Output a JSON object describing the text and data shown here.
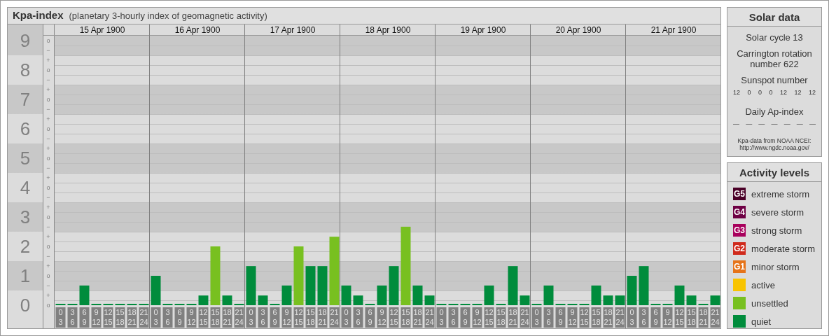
{
  "panel": {
    "title": "Kpa-index",
    "subtitle": "(planetary 3-hourly index of geomagnetic activity)",
    "days": [
      "15 Apr 1900",
      "16 Apr 1900",
      "17 Apr 1900",
      "18 Apr 1900",
      "19 Apr 1900",
      "20 Apr 1900",
      "21 Apr 1900"
    ],
    "third_marks": [
      "o",
      "−",
      "+",
      "o",
      "−",
      "+",
      "o",
      "−",
      "+",
      "o",
      "−",
      "+",
      "o",
      "−",
      "+",
      "o",
      "−",
      "+",
      "o",
      "−",
      "+",
      "o",
      "−",
      "+",
      "o",
      "−",
      "+",
      "o"
    ],
    "chart_data": {
      "type": "bar",
      "ylim": [
        0,
        9.55
      ],
      "grid": true,
      "yticks": [
        {
          "value": 0,
          "label": "0"
        },
        {
          "value": 1,
          "label": "1"
        },
        {
          "value": 2,
          "label": "2"
        },
        {
          "value": 3,
          "label": "3"
        },
        {
          "value": 4,
          "label": "4"
        },
        {
          "value": 5,
          "label": "5"
        },
        {
          "value": 6,
          "label": "6"
        },
        {
          "value": 7,
          "label": "7"
        },
        {
          "value": 8,
          "label": "8"
        },
        {
          "value": 9,
          "label": "9"
        }
      ],
      "categories": [
        "0\n3",
        "3\n6",
        "6\n9",
        "9\n12",
        "12\n15",
        "15\n18",
        "18\n21",
        "21\n24",
        "0\n3",
        "3\n6",
        "6\n9",
        "9\n12",
        "12\n15",
        "15\n18",
        "18\n21",
        "21\n24",
        "0\n3",
        "3\n6",
        "6\n9",
        "9\n12",
        "12\n15",
        "15\n18",
        "18\n21",
        "21\n24",
        "0\n3",
        "3\n6",
        "6\n9",
        "9\n12",
        "12\n15",
        "15\n18",
        "18\n21",
        "21\n24",
        "0\n3",
        "3\n6",
        "6\n9",
        "9\n12",
        "12\n15",
        "15\n18",
        "18\n21",
        "21\n24",
        "0\n3",
        "3\n6",
        "6\n9",
        "9\n12",
        "12\n15",
        "15\n18",
        "18\n21",
        "21\n24",
        "0\n3",
        "3\n6",
        "6\n9",
        "9\n12",
        "12\n15",
        "15\n18",
        "18\n21",
        "21\n24"
      ],
      "series": [
        {
          "color": "#008c3c",
          "values": [
            0,
            0,
            0.67,
            0,
            0,
            0,
            0,
            0,
            1,
            0,
            0,
            0,
            0.33,
            null,
            0.33,
            0,
            1.33,
            0.33,
            0,
            0.67,
            null,
            1.33,
            1.33,
            null,
            0.67,
            0.33,
            0,
            0.67,
            1.33,
            null,
            0.67,
            0.33,
            0,
            0,
            0,
            0,
            0.67,
            0,
            1.33,
            0.33,
            0,
            0.67,
            0,
            0,
            0,
            0.67,
            0.33,
            0.33,
            1,
            1.33,
            0,
            0,
            0.67,
            0.33,
            0,
            0.33
          ]
        },
        {
          "color": "#78c020",
          "values": [
            null,
            null,
            null,
            null,
            null,
            null,
            null,
            null,
            null,
            null,
            null,
            null,
            null,
            2,
            null,
            null,
            null,
            null,
            null,
            null,
            2,
            null,
            null,
            2.33,
            null,
            null,
            null,
            null,
            null,
            2.67,
            null,
            null,
            null,
            null,
            null,
            null,
            null,
            null,
            null,
            null,
            null,
            null,
            null,
            null,
            null,
            null,
            null,
            null,
            null,
            null,
            null,
            null,
            null,
            null,
            null,
            null
          ]
        }
      ]
    }
  },
  "solar_data": {
    "title": "Solar data",
    "solar_cycle": "Solar cycle 13",
    "carrington": "Carrington rotation number 622",
    "sunspot_title": "Sunspot number",
    "sunspot_numbers": [
      "12",
      "0",
      "0",
      "0",
      "12",
      "12",
      "12"
    ],
    "ap_title": "Daily Ap-index",
    "ap_values": [
      "—",
      "—",
      "—",
      "—",
      "—",
      "—",
      "—"
    ],
    "source": "Kpa-data from NOAA NCEI: http://www.ngdc.noaa.gov/"
  },
  "activity_levels": {
    "title": "Activity levels",
    "items": [
      {
        "code": "G5",
        "label": "extreme storm",
        "color": "#4a0027"
      },
      {
        "code": "G4",
        "label": "severe storm",
        "color": "#6e0044"
      },
      {
        "code": "G3",
        "label": "strong storm",
        "color": "#a8005c"
      },
      {
        "code": "G2",
        "label": "moderate storm",
        "color": "#d02a1c"
      },
      {
        "code": "G1",
        "label": "minor storm",
        "color": "#e6741a"
      },
      {
        "label": "active",
        "color": "#f8c400"
      },
      {
        "label": "unsettled",
        "color": "#78c020"
      },
      {
        "label": "quiet",
        "color": "#008c3c"
      }
    ]
  }
}
